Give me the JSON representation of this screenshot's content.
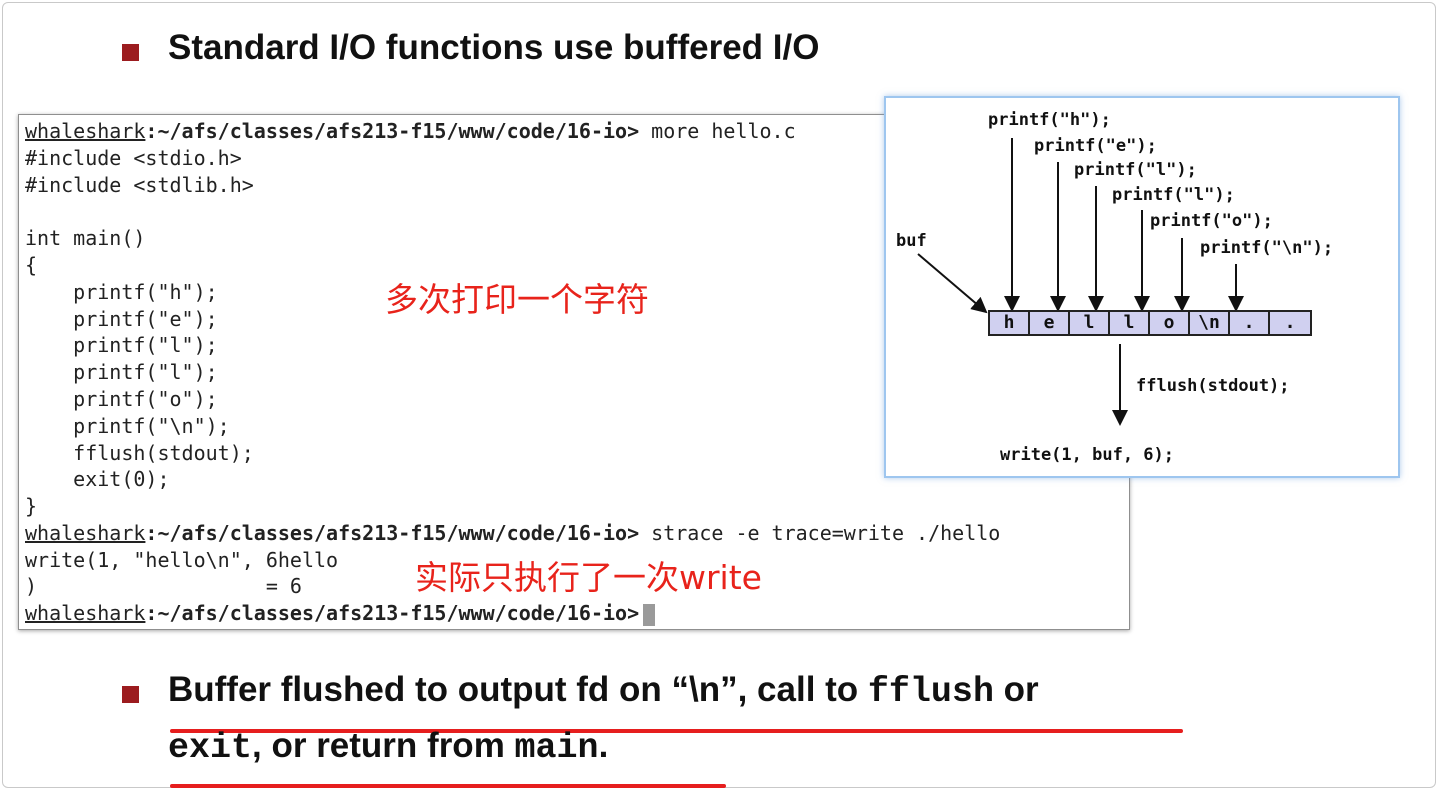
{
  "bullets": {
    "top_text": "Standard I/O functions use buffered I/O",
    "bottom_line1_a": "Buffer flushed to output fd on “\\n”, call to ",
    "bottom_line1_code": "fflush",
    "bottom_line1_b": " or",
    "bottom_line2_code1": "exit",
    "bottom_line2_a": ",  or return from ",
    "bottom_line2_code2": "main",
    "bottom_line2_b": "."
  },
  "terminal": {
    "host": "whaleshark",
    "path": ":~/afs/classes/afs213-f15/www/code/16-io>",
    "cmd1": " more hello.c",
    "code_lines": [
      "#include <stdio.h>",
      "#include <stdlib.h>",
      "",
      "int main()",
      "{",
      "    printf(\"h\");",
      "    printf(\"e\");",
      "    printf(\"l\");",
      "    printf(\"l\");",
      "    printf(\"o\");",
      "    printf(\"\\n\");",
      "    fflush(stdout);",
      "    exit(0);",
      "}"
    ],
    "cmd2": " strace -e trace=write ./hello",
    "out1": "write(1, \"hello\\n\", 6hello",
    "out2": ")                   = 6",
    "annotation_top": "多次打印一个字符",
    "annotation_bottom": "实际只执行了一次write"
  },
  "diagram": {
    "calls": [
      "printf(\"h\");",
      "printf(\"e\");",
      "printf(\"l\");",
      "printf(\"l\");",
      "printf(\"o\");",
      "printf(\"\\n\");"
    ],
    "buf_label": "buf",
    "cells": [
      "h",
      "e",
      "l",
      "l",
      "o",
      "\\n",
      ".",
      "."
    ],
    "flush_label": "fflush(stdout);",
    "write_label": "write(1, buf, 6);"
  },
  "colors": {
    "bullet": "#9c1c1f",
    "annotation": "#e8231b",
    "underline": "#e61e1e",
    "buffer_fill": "#d0d0f0",
    "diagram_border": "#9ec6ef"
  }
}
